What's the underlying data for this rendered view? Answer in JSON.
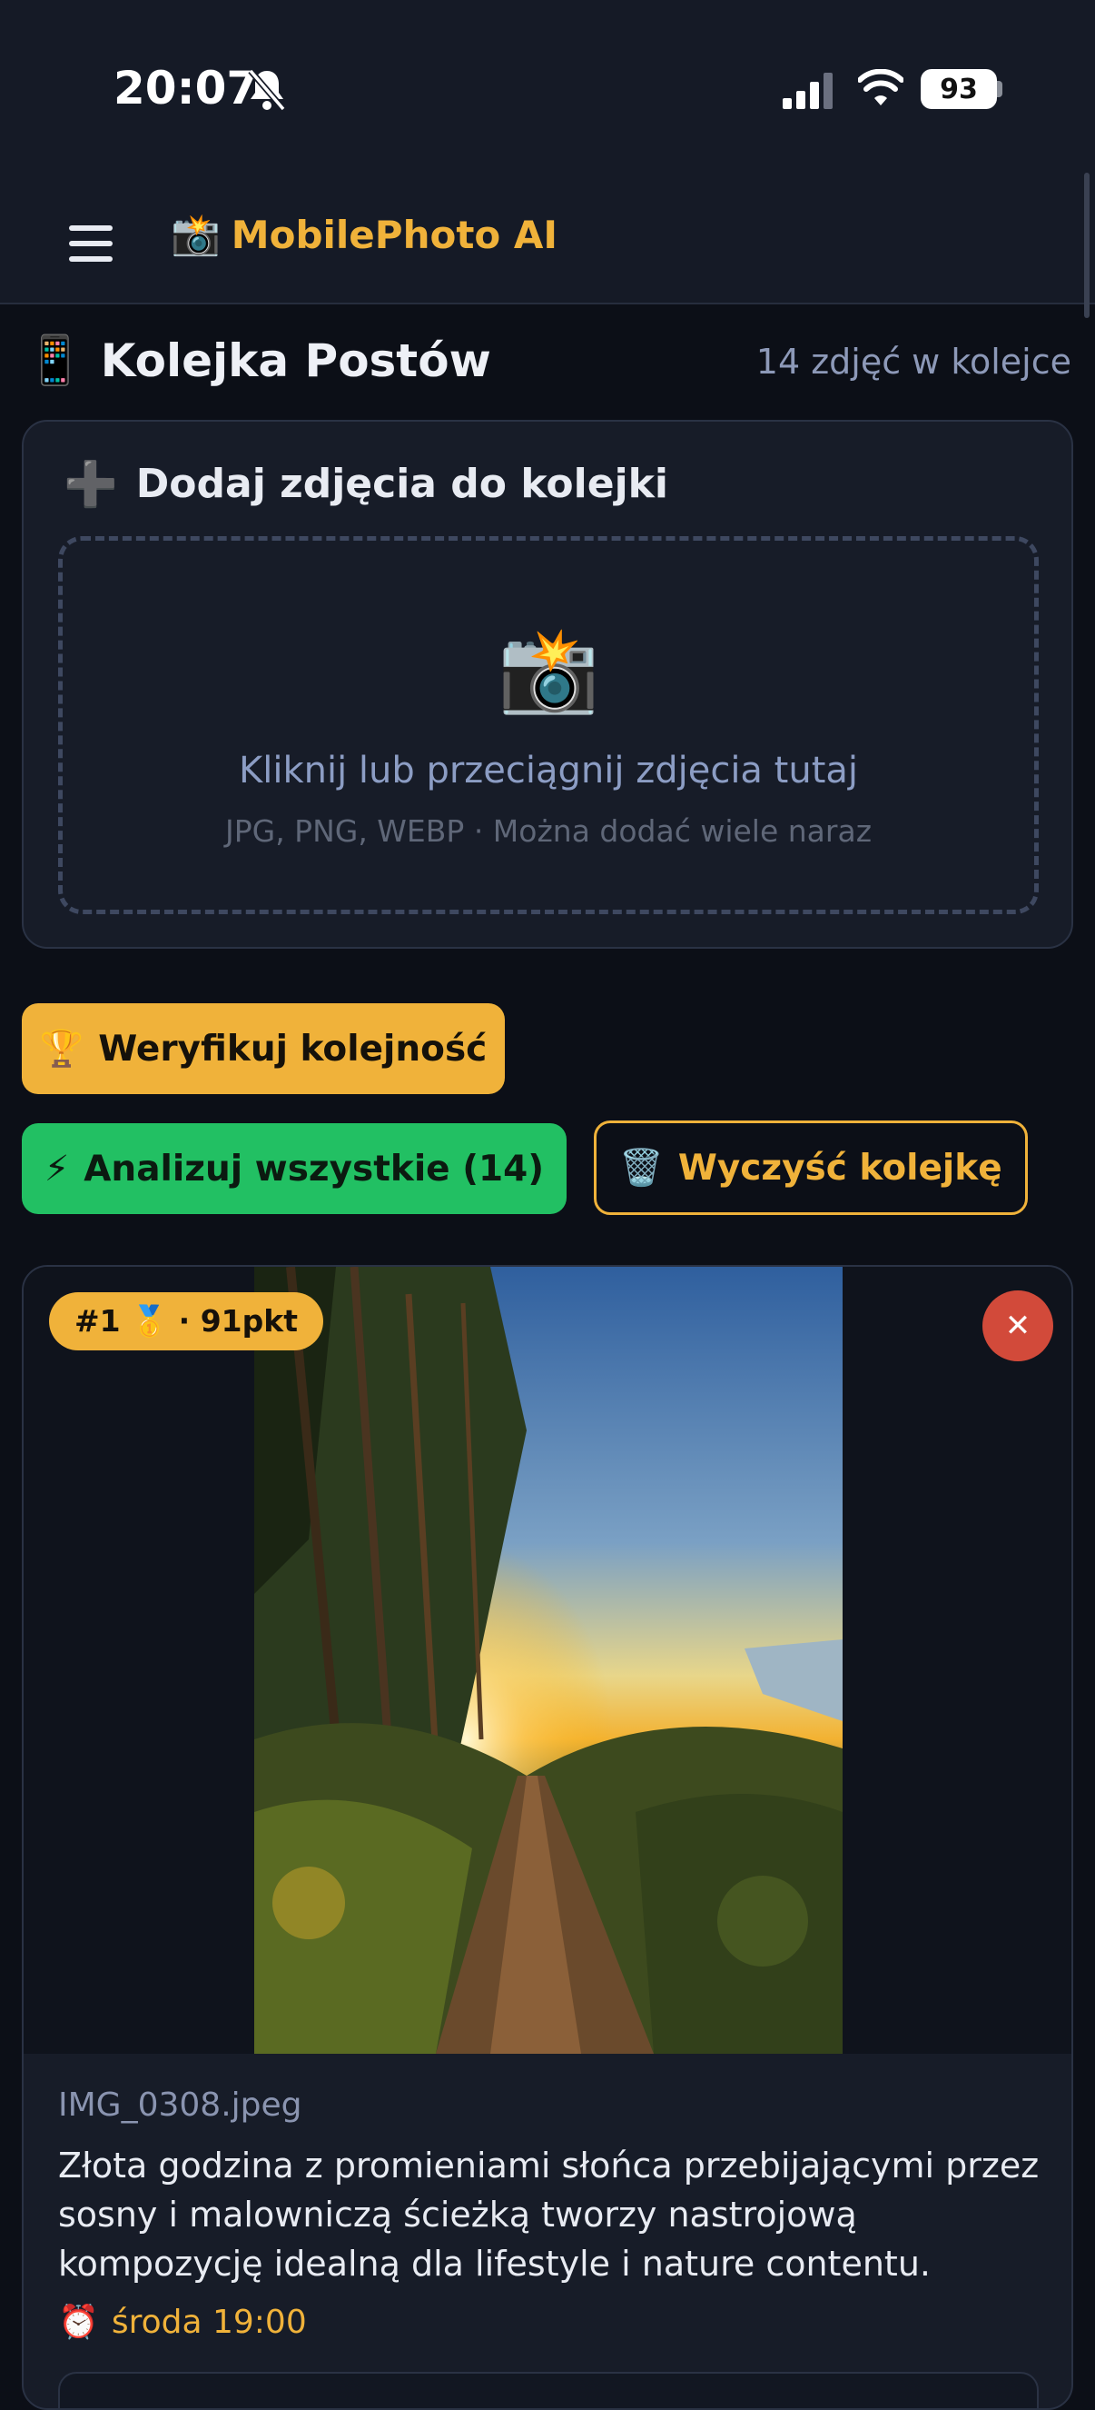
{
  "status_bar": {
    "time": "20:07",
    "battery": "93",
    "icons": [
      "bell-slash-icon",
      "signal-icon",
      "wifi-icon",
      "battery-icon"
    ]
  },
  "header": {
    "menu_icon": "hamburger-icon",
    "brand_emoji": "📸",
    "brand_name": "MobilePhoto AI",
    "accent_color": "#f0b23a"
  },
  "section": {
    "emoji": "📱",
    "title": "Kolejka Postów",
    "count": "14 zdjęć w kolejce"
  },
  "upload": {
    "icon": "➕",
    "title": "Dodaj zdjęcia do kolejki",
    "camera_emoji": "📸",
    "hint_main": "Kliknij lub przeciągnij zdjęcia tutaj",
    "hint_sub": "JPG, PNG, WEBP · Można dodać wiele naraz"
  },
  "actions": {
    "verify_emoji": "🏆",
    "verify_label": "Weryfikuj kolejność",
    "analyze_emoji": "⚡",
    "analyze_label": "Analizuj wszystkie (14)",
    "clear_emoji": "🗑️",
    "clear_label": "Wyczyść kolejkę"
  },
  "queue": [
    {
      "rank_badge": "#1 🥇 · 91pkt",
      "close_label": "✕",
      "filename": "IMG_0308.jpeg",
      "caption": "Złota godzina z promieniami słońca przebijającymi przez sosny i malowniczą ścieżką tworzy nastrojową kompozycję idealną dla lifestyle i nature contentu.",
      "schedule_emoji": "⏰",
      "schedule": "środa 19:00"
    }
  ]
}
